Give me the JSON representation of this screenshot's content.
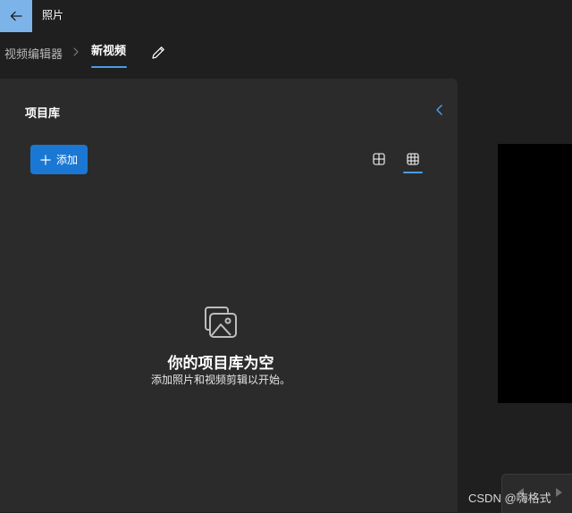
{
  "titlebar": {
    "app_title": "照片"
  },
  "breadcrumb": {
    "root": "视频编辑器",
    "current": "新视频"
  },
  "library": {
    "title": "项目库",
    "add_label": "添加",
    "empty_title": "你的项目库为空",
    "empty_subtitle": "添加照片和视频剪辑以开始。"
  },
  "watermark": "CSDN @嗨格式",
  "colors": {
    "accent": "#1a78d4",
    "back_button": "#7cb3e8",
    "underline": "#4a9de8",
    "panel_bg": "#2b2b2b",
    "page_bg": "#1f1f1f"
  },
  "icons": {
    "back": "arrow-left-icon",
    "separator": "chevron-right-icon",
    "edit": "pencil-icon",
    "collapse": "chevron-left-icon",
    "add": "plus-icon",
    "view_large": "grid-2x2-icon",
    "view_small": "grid-3x3-icon",
    "empty": "media-library-icon",
    "prev": "previous-icon",
    "next": "next-icon"
  }
}
